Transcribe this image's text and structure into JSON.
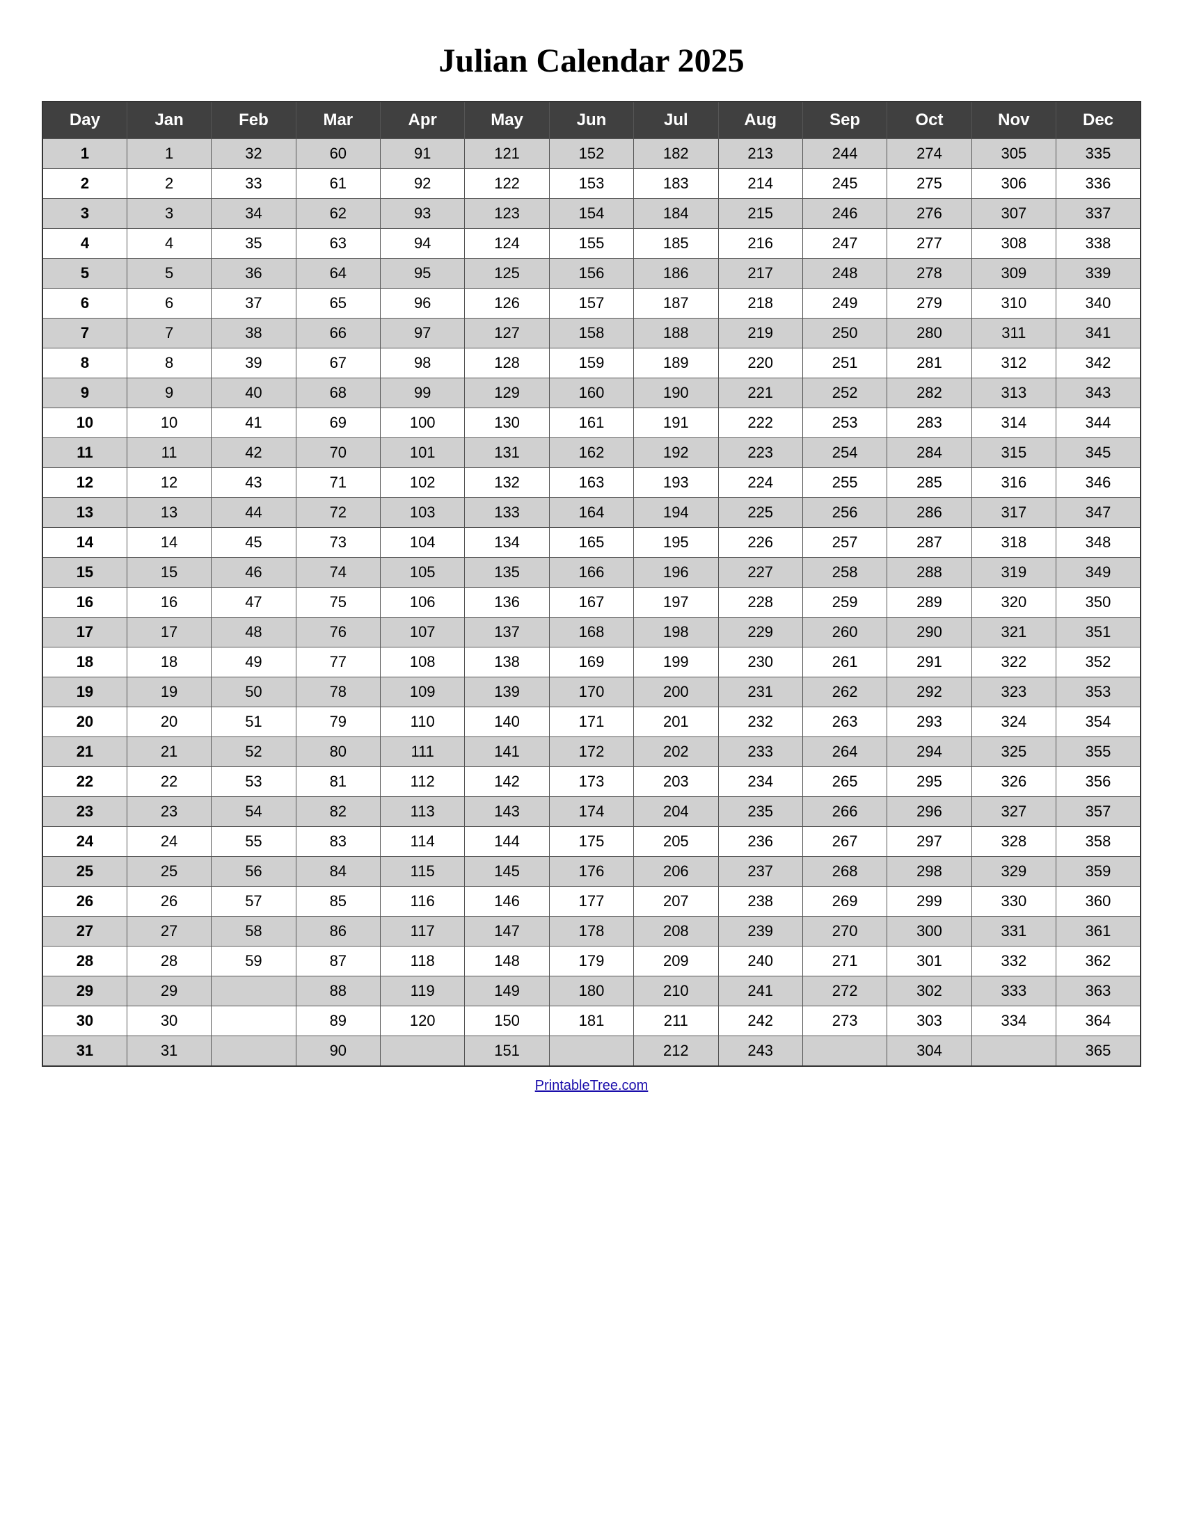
{
  "title": "Julian Calendar 2025",
  "footer": "PrintableTree.com",
  "headers": [
    "Day",
    "Jan",
    "Feb",
    "Mar",
    "Apr",
    "May",
    "Jun",
    "Jul",
    "Aug",
    "Sep",
    "Oct",
    "Nov",
    "Dec"
  ],
  "rows": [
    {
      "day": 1,
      "Jan": 1,
      "Feb": 32,
      "Mar": 60,
      "Apr": 91,
      "May": 121,
      "Jun": 152,
      "Jul": 182,
      "Aug": 213,
      "Sep": 244,
      "Oct": 274,
      "Nov": 305,
      "Dec": 335
    },
    {
      "day": 2,
      "Jan": 2,
      "Feb": 33,
      "Mar": 61,
      "Apr": 92,
      "May": 122,
      "Jun": 153,
      "Jul": 183,
      "Aug": 214,
      "Sep": 245,
      "Oct": 275,
      "Nov": 306,
      "Dec": 336
    },
    {
      "day": 3,
      "Jan": 3,
      "Feb": 34,
      "Mar": 62,
      "Apr": 93,
      "May": 123,
      "Jun": 154,
      "Jul": 184,
      "Aug": 215,
      "Sep": 246,
      "Oct": 276,
      "Nov": 307,
      "Dec": 337
    },
    {
      "day": 4,
      "Jan": 4,
      "Feb": 35,
      "Mar": 63,
      "Apr": 94,
      "May": 124,
      "Jun": 155,
      "Jul": 185,
      "Aug": 216,
      "Sep": 247,
      "Oct": 277,
      "Nov": 308,
      "Dec": 338
    },
    {
      "day": 5,
      "Jan": 5,
      "Feb": 36,
      "Mar": 64,
      "Apr": 95,
      "May": 125,
      "Jun": 156,
      "Jul": 186,
      "Aug": 217,
      "Sep": 248,
      "Oct": 278,
      "Nov": 309,
      "Dec": 339
    },
    {
      "day": 6,
      "Jan": 6,
      "Feb": 37,
      "Mar": 65,
      "Apr": 96,
      "May": 126,
      "Jun": 157,
      "Jul": 187,
      "Aug": 218,
      "Sep": 249,
      "Oct": 279,
      "Nov": 310,
      "Dec": 340
    },
    {
      "day": 7,
      "Jan": 7,
      "Feb": 38,
      "Mar": 66,
      "Apr": 97,
      "May": 127,
      "Jun": 158,
      "Jul": 188,
      "Aug": 219,
      "Sep": 250,
      "Oct": 280,
      "Nov": 311,
      "Dec": 341
    },
    {
      "day": 8,
      "Jan": 8,
      "Feb": 39,
      "Mar": 67,
      "Apr": 98,
      "May": 128,
      "Jun": 159,
      "Jul": 189,
      "Aug": 220,
      "Sep": 251,
      "Oct": 281,
      "Nov": 312,
      "Dec": 342
    },
    {
      "day": 9,
      "Jan": 9,
      "Feb": 40,
      "Mar": 68,
      "Apr": 99,
      "May": 129,
      "Jun": 160,
      "Jul": 190,
      "Aug": 221,
      "Sep": 252,
      "Oct": 282,
      "Nov": 313,
      "Dec": 343
    },
    {
      "day": 10,
      "Jan": 10,
      "Feb": 41,
      "Mar": 69,
      "Apr": 100,
      "May": 130,
      "Jun": 161,
      "Jul": 191,
      "Aug": 222,
      "Sep": 253,
      "Oct": 283,
      "Nov": 314,
      "Dec": 344
    },
    {
      "day": 11,
      "Jan": 11,
      "Feb": 42,
      "Mar": 70,
      "Apr": 101,
      "May": 131,
      "Jun": 162,
      "Jul": 192,
      "Aug": 223,
      "Sep": 254,
      "Oct": 284,
      "Nov": 315,
      "Dec": 345
    },
    {
      "day": 12,
      "Jan": 12,
      "Feb": 43,
      "Mar": 71,
      "Apr": 102,
      "May": 132,
      "Jun": 163,
      "Jul": 193,
      "Aug": 224,
      "Sep": 255,
      "Oct": 285,
      "Nov": 316,
      "Dec": 346
    },
    {
      "day": 13,
      "Jan": 13,
      "Feb": 44,
      "Mar": 72,
      "Apr": 103,
      "May": 133,
      "Jun": 164,
      "Jul": 194,
      "Aug": 225,
      "Sep": 256,
      "Oct": 286,
      "Nov": 317,
      "Dec": 347
    },
    {
      "day": 14,
      "Jan": 14,
      "Feb": 45,
      "Mar": 73,
      "Apr": 104,
      "May": 134,
      "Jun": 165,
      "Jul": 195,
      "Aug": 226,
      "Sep": 257,
      "Oct": 287,
      "Nov": 318,
      "Dec": 348
    },
    {
      "day": 15,
      "Jan": 15,
      "Feb": 46,
      "Mar": 74,
      "Apr": 105,
      "May": 135,
      "Jun": 166,
      "Jul": 196,
      "Aug": 227,
      "Sep": 258,
      "Oct": 288,
      "Nov": 319,
      "Dec": 349
    },
    {
      "day": 16,
      "Jan": 16,
      "Feb": 47,
      "Mar": 75,
      "Apr": 106,
      "May": 136,
      "Jun": 167,
      "Jul": 197,
      "Aug": 228,
      "Sep": 259,
      "Oct": 289,
      "Nov": 320,
      "Dec": 350
    },
    {
      "day": 17,
      "Jan": 17,
      "Feb": 48,
      "Mar": 76,
      "Apr": 107,
      "May": 137,
      "Jun": 168,
      "Jul": 198,
      "Aug": 229,
      "Sep": 260,
      "Oct": 290,
      "Nov": 321,
      "Dec": 351
    },
    {
      "day": 18,
      "Jan": 18,
      "Feb": 49,
      "Mar": 77,
      "Apr": 108,
      "May": 138,
      "Jun": 169,
      "Jul": 199,
      "Aug": 230,
      "Sep": 261,
      "Oct": 291,
      "Nov": 322,
      "Dec": 352
    },
    {
      "day": 19,
      "Jan": 19,
      "Feb": 50,
      "Mar": 78,
      "Apr": 109,
      "May": 139,
      "Jun": 170,
      "Jul": 200,
      "Aug": 231,
      "Sep": 262,
      "Oct": 292,
      "Nov": 323,
      "Dec": 353
    },
    {
      "day": 20,
      "Jan": 20,
      "Feb": 51,
      "Mar": 79,
      "Apr": 110,
      "May": 140,
      "Jun": 171,
      "Jul": 201,
      "Aug": 232,
      "Sep": 263,
      "Oct": 293,
      "Nov": 324,
      "Dec": 354
    },
    {
      "day": 21,
      "Jan": 21,
      "Feb": 52,
      "Mar": 80,
      "Apr": 111,
      "May": 141,
      "Jun": 172,
      "Jul": 202,
      "Aug": 233,
      "Sep": 264,
      "Oct": 294,
      "Nov": 325,
      "Dec": 355
    },
    {
      "day": 22,
      "Jan": 22,
      "Feb": 53,
      "Mar": 81,
      "Apr": 112,
      "May": 142,
      "Jun": 173,
      "Jul": 203,
      "Aug": 234,
      "Sep": 265,
      "Oct": 295,
      "Nov": 326,
      "Dec": 356
    },
    {
      "day": 23,
      "Jan": 23,
      "Feb": 54,
      "Mar": 82,
      "Apr": 113,
      "May": 143,
      "Jun": 174,
      "Jul": 204,
      "Aug": 235,
      "Sep": 266,
      "Oct": 296,
      "Nov": 327,
      "Dec": 357
    },
    {
      "day": 24,
      "Jan": 24,
      "Feb": 55,
      "Mar": 83,
      "Apr": 114,
      "May": 144,
      "Jun": 175,
      "Jul": 205,
      "Aug": 236,
      "Sep": 267,
      "Oct": 297,
      "Nov": 328,
      "Dec": 358
    },
    {
      "day": 25,
      "Jan": 25,
      "Feb": 56,
      "Mar": 84,
      "Apr": 115,
      "May": 145,
      "Jun": 176,
      "Jul": 206,
      "Aug": 237,
      "Sep": 268,
      "Oct": 298,
      "Nov": 329,
      "Dec": 359
    },
    {
      "day": 26,
      "Jan": 26,
      "Feb": 57,
      "Mar": 85,
      "Apr": 116,
      "May": 146,
      "Jun": 177,
      "Jul": 207,
      "Aug": 238,
      "Sep": 269,
      "Oct": 299,
      "Nov": 330,
      "Dec": 360
    },
    {
      "day": 27,
      "Jan": 27,
      "Feb": 58,
      "Mar": 86,
      "Apr": 117,
      "May": 147,
      "Jun": 178,
      "Jul": 208,
      "Aug": 239,
      "Sep": 270,
      "Oct": 300,
      "Nov": 331,
      "Dec": 361
    },
    {
      "day": 28,
      "Jan": 28,
      "Feb": 59,
      "Mar": 87,
      "Apr": 118,
      "May": 148,
      "Jun": 179,
      "Jul": 209,
      "Aug": 240,
      "Sep": 271,
      "Oct": 301,
      "Nov": 332,
      "Dec": 362
    },
    {
      "day": 29,
      "Jan": 29,
      "Feb": null,
      "Mar": 88,
      "Apr": 119,
      "May": 149,
      "Jun": 180,
      "Jul": 210,
      "Aug": 241,
      "Sep": 272,
      "Oct": 302,
      "Nov": 333,
      "Dec": 363
    },
    {
      "day": 30,
      "Jan": 30,
      "Feb": null,
      "Mar": 89,
      "Apr": 120,
      "May": 150,
      "Jun": 181,
      "Jul": 211,
      "Aug": 242,
      "Sep": 273,
      "Oct": 303,
      "Nov": 334,
      "Dec": 364
    },
    {
      "day": 31,
      "Jan": 31,
      "Feb": null,
      "Mar": 90,
      "Apr": null,
      "May": 151,
      "Jun": null,
      "Jul": 212,
      "Aug": 243,
      "Sep": null,
      "Oct": 304,
      "Nov": null,
      "Dec": 365
    }
  ]
}
